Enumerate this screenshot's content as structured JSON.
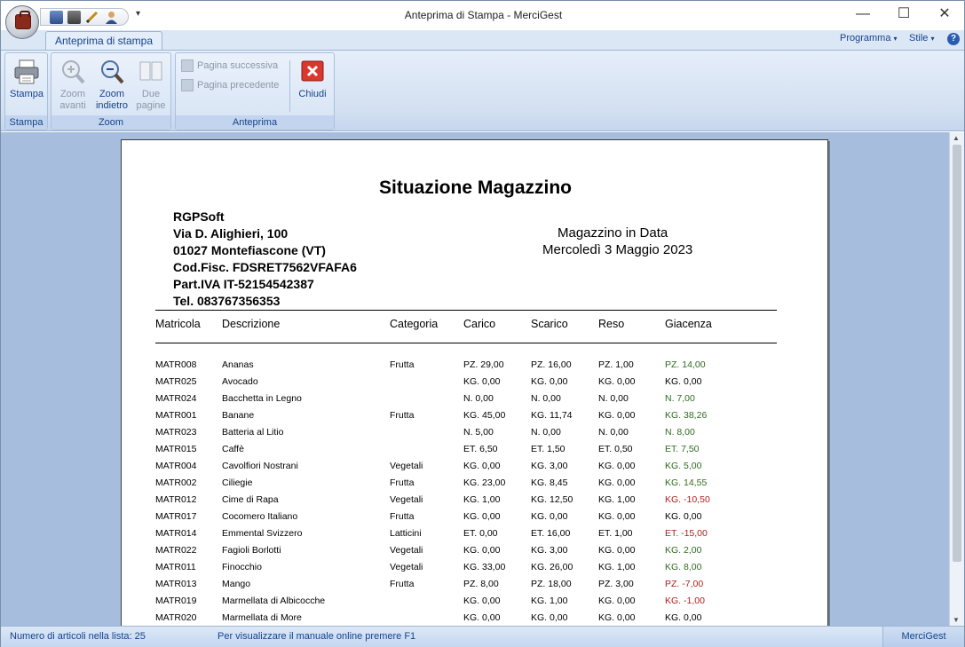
{
  "window": {
    "title": "Anteprima di Stampa - MerciGest",
    "minimize": "—",
    "maximize": "☐",
    "close": "✕"
  },
  "qat": {
    "dropdown": "▾"
  },
  "ribbon": {
    "tab": "Anteprima di stampa",
    "programma": "Programma",
    "stile": "Stile",
    "help": "?",
    "groups": {
      "stampa": {
        "label": "Stampa",
        "stampa_btn": "Stampa"
      },
      "zoom": {
        "label": "Zoom",
        "zoom_avanti_1": "Zoom",
        "zoom_avanti_2": "avanti",
        "zoom_indietro_1": "Zoom",
        "zoom_indietro_2": "indietro",
        "due_pagine_1": "Due",
        "due_pagine_2": "pagine"
      },
      "anteprima": {
        "label": "Anteprima",
        "pagina_successiva": "Pagina successiva",
        "pagina_precedente": "Pagina precedente",
        "chiudi": "Chiudi"
      }
    }
  },
  "report": {
    "title": "Situazione Magazzino",
    "company": {
      "name": "RGPSoft",
      "address": "Via D. Alighieri, 100",
      "city": "01027 Montefiascone (VT)",
      "codfisc": "Cod.Fisc. FDSRET7562VFAFA6",
      "piva": "Part.IVA IT-52154542387",
      "tel": "Tel. 083767356353"
    },
    "subtitle": "Magazzino in Data",
    "date": "Mercoledì  3 Maggio 2023",
    "columns": [
      "Matricola",
      "Descrizione",
      "Categoria",
      "Carico",
      "Scarico",
      "Reso",
      "Giacenza"
    ],
    "rows": [
      {
        "matricola": "MATR008",
        "descrizione": "Ananas",
        "categoria": "Frutta",
        "carico": "PZ. 29,00",
        "scarico": "PZ. 16,00",
        "reso": "PZ. 1,00",
        "giacenza": "PZ. 14,00",
        "stato": "pos"
      },
      {
        "matricola": "MATR025",
        "descrizione": "Avocado",
        "categoria": "",
        "carico": "KG. 0,00",
        "scarico": "KG. 0,00",
        "reso": "KG. 0,00",
        "giacenza": "KG. 0,00",
        "stato": "zero"
      },
      {
        "matricola": "MATR024",
        "descrizione": "Bacchetta in Legno",
        "categoria": "",
        "carico": "N. 0,00",
        "scarico": "N. 0,00",
        "reso": "N. 0,00",
        "giacenza": "N. 7,00",
        "stato": "pos"
      },
      {
        "matricola": "MATR001",
        "descrizione": "Banane",
        "categoria": "Frutta",
        "carico": "KG. 45,00",
        "scarico": "KG. 11,74",
        "reso": "KG. 0,00",
        "giacenza": "KG. 38,26",
        "stato": "pos"
      },
      {
        "matricola": "MATR023",
        "descrizione": "Batteria al Litio",
        "categoria": "",
        "carico": "N. 5,00",
        "scarico": "N. 0,00",
        "reso": "N. 0,00",
        "giacenza": "N. 8,00",
        "stato": "pos"
      },
      {
        "matricola": "MATR015",
        "descrizione": "Caffè",
        "categoria": "",
        "carico": "ET. 6,50",
        "scarico": "ET. 1,50",
        "reso": "ET. 0,50",
        "giacenza": "ET. 7,50",
        "stato": "pos"
      },
      {
        "matricola": "MATR004",
        "descrizione": "Cavolfiori Nostrani",
        "categoria": "Vegetali",
        "carico": "KG. 0,00",
        "scarico": "KG. 3,00",
        "reso": "KG. 0,00",
        "giacenza": "KG. 5,00",
        "stato": "pos"
      },
      {
        "matricola": "MATR002",
        "descrizione": "Ciliegie",
        "categoria": "Frutta",
        "carico": "KG. 23,00",
        "scarico": "KG. 8,45",
        "reso": "KG. 0,00",
        "giacenza": "KG. 14,55",
        "stato": "pos"
      },
      {
        "matricola": "MATR012",
        "descrizione": "Cime di Rapa",
        "categoria": "Vegetali",
        "carico": "KG. 1,00",
        "scarico": "KG. 12,50",
        "reso": "KG. 1,00",
        "giacenza": "KG. -10,50",
        "stato": "neg"
      },
      {
        "matricola": "MATR017",
        "descrizione": "Cocomero Italiano",
        "categoria": "Frutta",
        "carico": "KG. 0,00",
        "scarico": "KG. 0,00",
        "reso": "KG. 0,00",
        "giacenza": "KG. 0,00",
        "stato": "zero"
      },
      {
        "matricola": "MATR014",
        "descrizione": "Emmental Svizzero",
        "categoria": "Latticini",
        "carico": "ET. 0,00",
        "scarico": "ET. 16,00",
        "reso": "ET. 1,00",
        "giacenza": "ET. -15,00",
        "stato": "neg"
      },
      {
        "matricola": "MATR022",
        "descrizione": "Fagioli Borlotti",
        "categoria": "Vegetali",
        "carico": "KG. 0,00",
        "scarico": "KG. 3,00",
        "reso": "KG. 0,00",
        "giacenza": "KG. 2,00",
        "stato": "pos"
      },
      {
        "matricola": "MATR011",
        "descrizione": "Finocchio",
        "categoria": "Vegetali",
        "carico": "KG. 33,00",
        "scarico": "KG. 26,00",
        "reso": "KG. 1,00",
        "giacenza": "KG. 8,00",
        "stato": "pos"
      },
      {
        "matricola": "MATR013",
        "descrizione": "Mango",
        "categoria": "Frutta",
        "carico": "PZ. 8,00",
        "scarico": "PZ. 18,00",
        "reso": "PZ. 3,00",
        "giacenza": "PZ. -7,00",
        "stato": "neg"
      },
      {
        "matricola": "MATR019",
        "descrizione": "Marmellata di Albicocche",
        "categoria": "",
        "carico": "KG. 0,00",
        "scarico": "KG. 1,00",
        "reso": "KG. 0,00",
        "giacenza": "KG. -1,00",
        "stato": "neg"
      },
      {
        "matricola": "MATR020",
        "descrizione": "Marmellata di More",
        "categoria": "",
        "carico": "KG. 0,00",
        "scarico": "KG. 0,00",
        "reso": "KG. 0,00",
        "giacenza": "KG. 0,00",
        "stato": "zero"
      }
    ]
  },
  "status": {
    "left": "Numero di articoli nella lista: 25",
    "middle": "Per visualizzare il manuale online premere F1",
    "right": "MerciGest"
  },
  "colors": {
    "positive": "#2e6b1e",
    "negative": "#b0201c",
    "ribbon_text": "#15428b",
    "workspace": "#a6bddd"
  }
}
